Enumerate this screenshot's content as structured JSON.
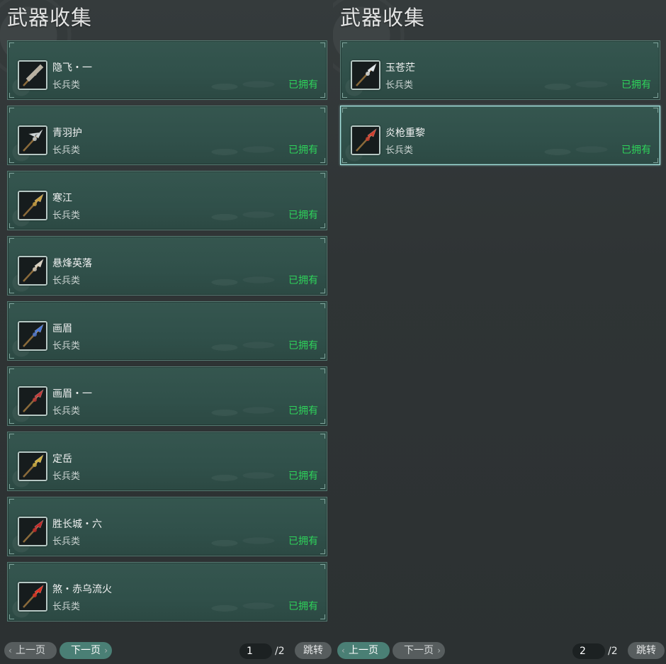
{
  "panels": [
    {
      "title": "武器收集",
      "items": [
        {
          "name": "隐飞・一",
          "type": "长兵类",
          "status": "已拥有",
          "icon": "sword-icon",
          "color": "#b8b0a0"
        },
        {
          "name": "青羽护",
          "type": "长兵类",
          "status": "已拥有",
          "icon": "halberd-icon",
          "color": "#cfd6d8"
        },
        {
          "name": "寒江",
          "type": "长兵类",
          "status": "已拥有",
          "icon": "spear-icon",
          "color": "#c9a040"
        },
        {
          "name": "悬烽英落",
          "type": "长兵类",
          "status": "已拥有",
          "icon": "spear-icon",
          "color": "#d8d0c0"
        },
        {
          "name": "画眉",
          "type": "长兵类",
          "status": "已拥有",
          "icon": "spear-icon",
          "color": "#4a78d8"
        },
        {
          "name": "画眉・一",
          "type": "长兵类",
          "status": "已拥有",
          "icon": "spear-icon",
          "color": "#c03838"
        },
        {
          "name": "定岳",
          "type": "长兵类",
          "status": "已拥有",
          "icon": "spear-icon",
          "color": "#d0b040"
        },
        {
          "name": "胜长城・六",
          "type": "长兵类",
          "status": "已拥有",
          "icon": "spear-icon",
          "color": "#c02828"
        },
        {
          "name": "煞・赤乌流火",
          "type": "长兵类",
          "status": "已拥有",
          "icon": "spear-icon",
          "color": "#e03020"
        }
      ],
      "pager": {
        "prev": "上一页",
        "next": "下一页",
        "current": "1",
        "total": "/2",
        "jump": "跳转",
        "active": "next"
      }
    },
    {
      "title": "武器收集",
      "items": [
        {
          "name": "玉苍茫",
          "type": "长兵类",
          "status": "已拥有",
          "icon": "spear-icon",
          "color": "#dfe6ea"
        },
        {
          "name": "炎枪重黎",
          "type": "长兵类",
          "status": "已拥有",
          "icon": "spear-icon",
          "color": "#d04030"
        }
      ],
      "selected_index": 1,
      "pager": {
        "prev": "上一页",
        "next": "下一页",
        "current": "2",
        "total": "/2",
        "jump": "跳转",
        "active": "prev"
      }
    }
  ],
  "colors": {
    "owned": "#2ed25a",
    "card_bg": "#30504a",
    "selected_border": "#a8e4e0"
  }
}
